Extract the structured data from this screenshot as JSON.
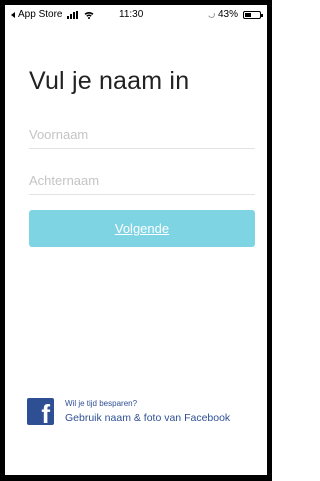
{
  "status_bar": {
    "back_label": "App Store",
    "time": "11:30",
    "battery_percent": "43%",
    "battery_level": 0.43
  },
  "page": {
    "title": "Vul je naam in"
  },
  "form": {
    "first_name_placeholder": "Voornaam",
    "last_name_placeholder": "Achternaam",
    "next_button_label": "Volgende"
  },
  "facebook": {
    "question": "Wil je tijd besparen?",
    "link_label": "Gebruik naam & foto van Facebook",
    "brand_color": "#2f4f94"
  },
  "colors": {
    "button": "#7fd4e4"
  }
}
